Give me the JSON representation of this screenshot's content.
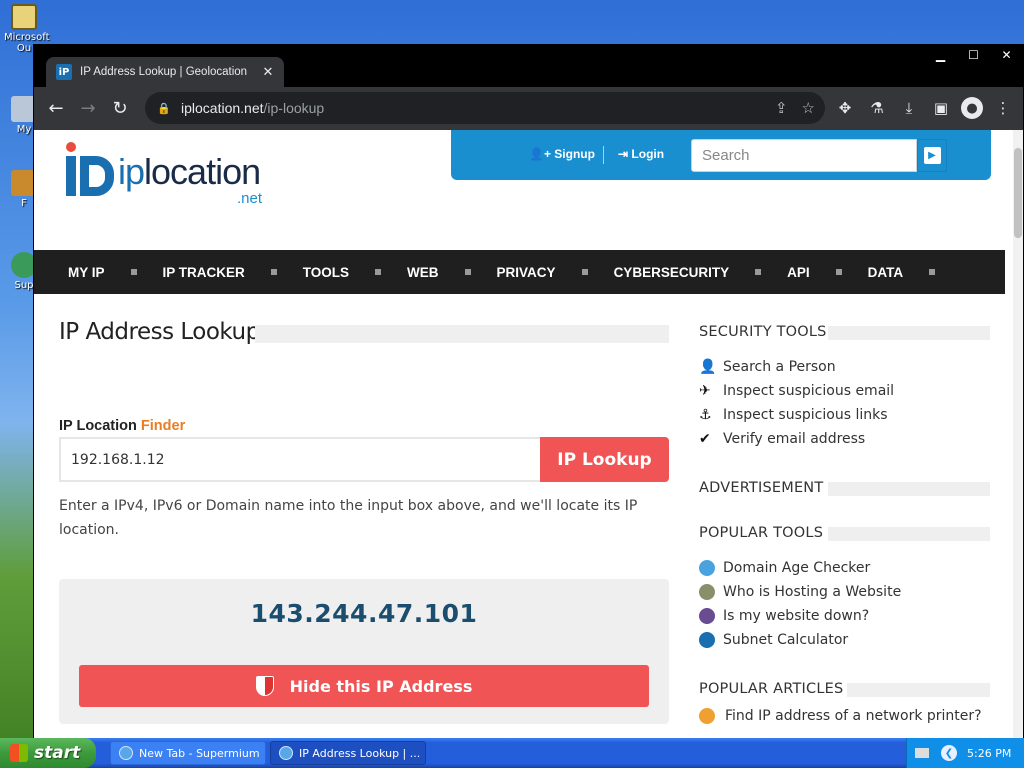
{
  "desktop": {
    "icons": [
      {
        "label": "Microsoft Ou",
        "icon": "outlook-icon"
      },
      {
        "label": "My",
        "icon": "my-computer-icon"
      },
      {
        "label": "F",
        "icon": "folder-icon"
      },
      {
        "label": "Sup",
        "icon": "support-icon"
      }
    ]
  },
  "browser": {
    "tab_title": "IP Address Lookup | Geolocation",
    "tab_close": "✕",
    "favicon_text": "iP",
    "url_domain": "iplocation.net",
    "url_path": "/ip-lookup",
    "window_controls": {
      "minimize": "▁",
      "maximize": "☐",
      "close": "✕"
    }
  },
  "site": {
    "logo": {
      "ip": "ip",
      "location": "location",
      "net": ".net"
    },
    "account": {
      "signup": "Signup",
      "login": "Login",
      "search_placeholder": "Search"
    },
    "nav": [
      "MY IP",
      "IP TRACKER",
      "TOOLS",
      "WEB",
      "PRIVACY",
      "CYBERSECURITY",
      "API",
      "DATA"
    ],
    "main": {
      "title": "IP Address Lookup",
      "finder_label": "IP Location",
      "finder_accent": "Finder",
      "input_value": "192.168.1.12",
      "lookup_button": "IP Lookup",
      "help_text": "Enter a IPv4, IPv6 or Domain name into the input box above, and we'll locate its IP location.",
      "result_ip": "143.244.47.101",
      "hide_button": "Hide this IP Address"
    },
    "sidebar": {
      "security_heading": "SECURITY TOOLS",
      "security_items": [
        {
          "label": "Search a Person",
          "icon": "person-icon",
          "glyph": "👤"
        },
        {
          "label": "Inspect suspicious email",
          "icon": "paper-plane-icon",
          "glyph": "✈"
        },
        {
          "label": "Inspect suspicious links",
          "icon": "hook-icon",
          "glyph": "⚓"
        },
        {
          "label": "Verify email address",
          "icon": "check-icon",
          "glyph": "✔"
        }
      ],
      "ad_heading": "ADVERTISEMENT",
      "popular_heading": "POPULAR TOOLS",
      "popular_items": [
        {
          "label": "Domain Age Checker",
          "icon": "globe-icon",
          "color": "#4aa3df"
        },
        {
          "label": "Who is Hosting a Website",
          "icon": "server-icon",
          "color": "#8a8f6a"
        },
        {
          "label": "Is my website down?",
          "icon": "status-icon",
          "color": "#6a4c93"
        },
        {
          "label": "Subnet Calculator",
          "icon": "network-icon",
          "color": "#1a6fb0"
        }
      ],
      "articles_heading": "POPULAR ARTICLES",
      "article_items": [
        {
          "label": "Find IP address of a network printer?",
          "icon": "article-icon",
          "color": "#f0a030"
        }
      ]
    }
  },
  "taskbar": {
    "start": "start",
    "tasks": [
      {
        "label": "New Tab - Supermium",
        "active": false
      },
      {
        "label": "IP Address Lookup | ...",
        "active": true
      }
    ],
    "clock": "5:26 PM"
  }
}
